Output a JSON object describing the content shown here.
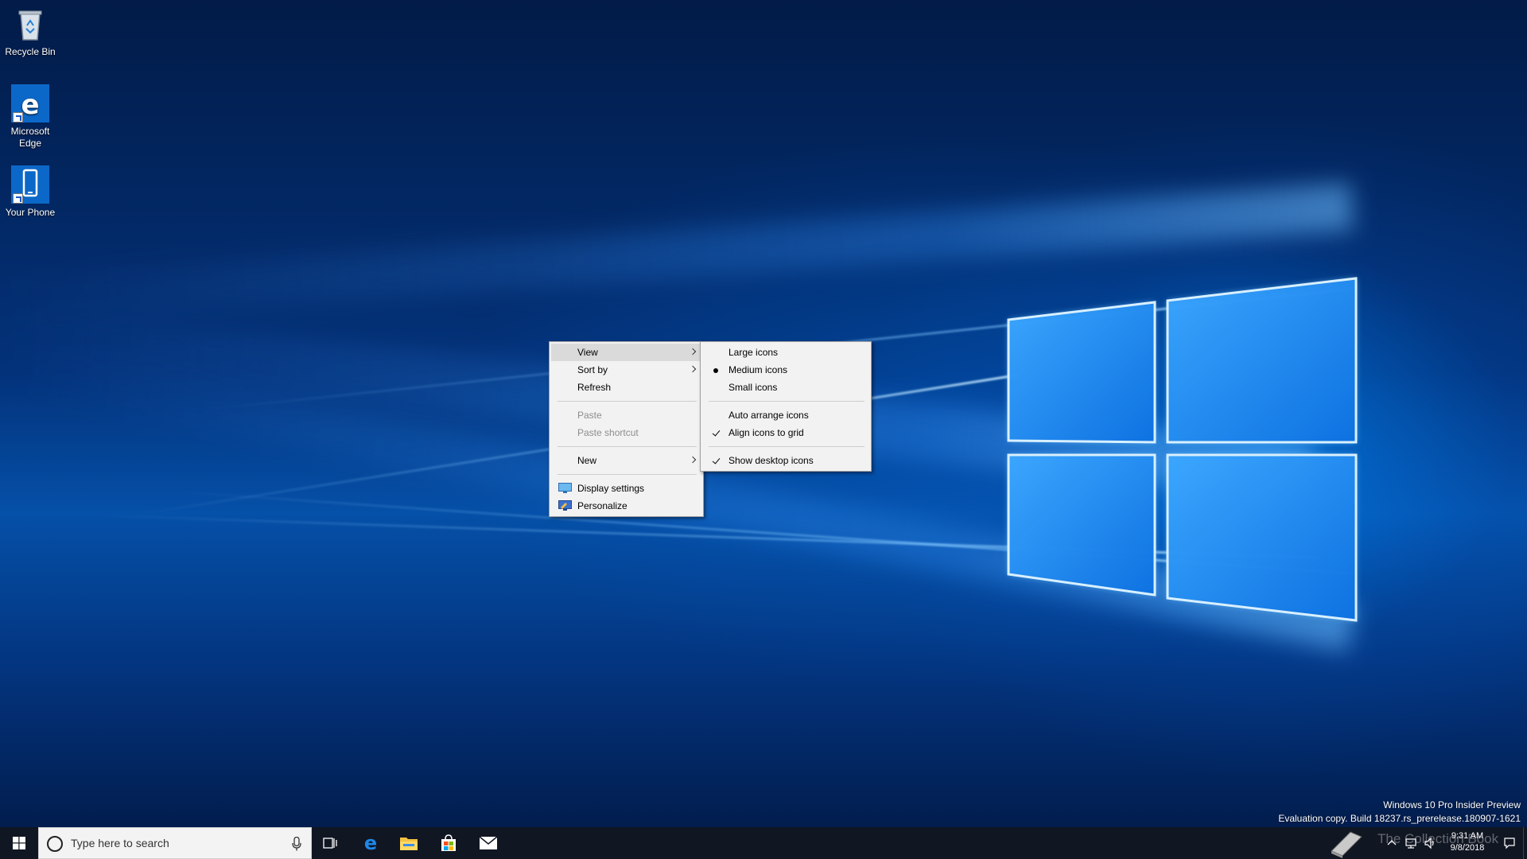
{
  "desktop": {
    "icons": [
      {
        "label": "Recycle Bin",
        "icon": "recycle-bin-icon"
      },
      {
        "label": "Microsoft Edge",
        "icon": "edge-icon"
      },
      {
        "label": "Your Phone",
        "icon": "phone-icon"
      }
    ]
  },
  "context_menu": {
    "items": {
      "view": "View",
      "sort_by": "Sort by",
      "refresh": "Refresh",
      "paste": "Paste",
      "paste_shortcut": "Paste shortcut",
      "new": "New",
      "display_settings": "Display settings",
      "personalize": "Personalize"
    },
    "highlighted": "View",
    "disabled": [
      "Paste",
      "Paste shortcut"
    ]
  },
  "view_submenu": {
    "items": {
      "large_icons": "Large icons",
      "medium_icons": "Medium icons",
      "small_icons": "Small icons",
      "auto_arrange": "Auto arrange icons",
      "align_to_grid": "Align icons to grid",
      "show_desktop_icons": "Show desktop icons"
    },
    "selected_size": "Medium icons",
    "checked": [
      "Align icons to grid",
      "Show desktop icons"
    ]
  },
  "watermark": {
    "line1": "Windows 10 Pro Insider Preview",
    "line2": "Evaluation copy. Build 18237.rs_prerelease.180907-1621"
  },
  "taskbar": {
    "search_placeholder": "Type here to search",
    "pinned": [
      "task-view-icon",
      "edge-icon",
      "file-explorer-icon",
      "store-icon",
      "mail-icon"
    ],
    "clock_time": "9:31 AM",
    "clock_date": "9/8/2018",
    "overlay_text": "The Collection Book"
  },
  "colors": {
    "taskbar": "#101622",
    "menu_bg": "#f2f2f2",
    "menu_hover": "#dadada",
    "accent": "#0078d7"
  }
}
